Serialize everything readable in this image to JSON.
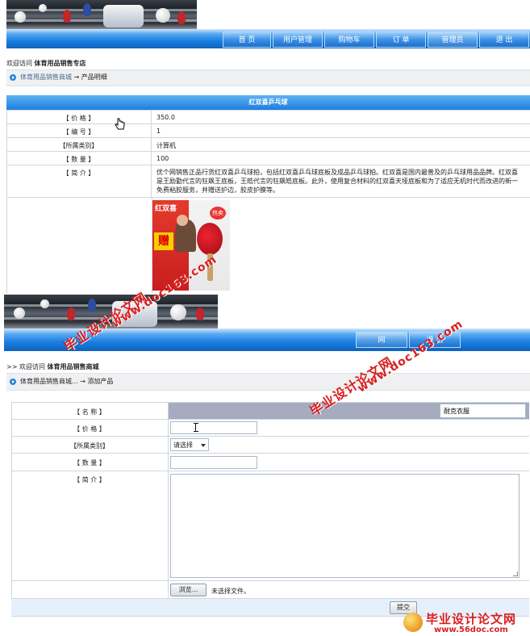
{
  "top": {
    "nav": [
      "首 页",
      "用户管理",
      "购物车",
      "订 单",
      "管理员",
      "退 出"
    ],
    "welcome_prefix": "欢迎访问",
    "welcome_site": "体育用品销售专店",
    "crumb_link": "体育用品销售商城",
    "crumb_arrow": "→",
    "crumb_page": "产品明细",
    "product_title": "红双喜乒乓球",
    "rows": [
      {
        "label": "【 价 格 】",
        "value": "350.0"
      },
      {
        "label": "【 编 号 】",
        "value": "1"
      },
      {
        "label": "【所属类别】",
        "value": "计算机"
      },
      {
        "label": "【 数 量 】",
        "value": "100"
      }
    ],
    "intro_label": "【 简 介 】",
    "intro_lines": [
      "优个网销售正品行货红双喜乒乓球拍，包括红双喜乒乓球底板及成品乒乓球拍。红双喜是国内最普及的乒乓球用品品牌。红双喜",
      "是王励勤代言的狂飙王底板，王皓代言的狂飙皓底板。此外，使用复合材料的红双喜天垭底板和为了适应无机时代而改进的新一",
      "免费粘胶服务，并赠送护边，胶皮护膜等。"
    ],
    "image_text": {
      "brand": "红双喜",
      "badge": "热卖",
      "gift": "赠"
    }
  },
  "bottom": {
    "nav": [
      "网",
      "退 出"
    ],
    "welcome_prefix": ">> 欢迎访问",
    "welcome_site": "体育用品销售商城",
    "crumb_link": "体育用品销售商城...",
    "crumb_arrow": "→",
    "crumb_page": "添加产品",
    "fields": {
      "name_label": "【 名 称 】",
      "name_value": "耐克衣服",
      "price_label": "【 价 格 】",
      "price_value": "",
      "category_label": "【所属类别】",
      "category_selected": "请选择",
      "quantity_label": "【 数 量 】",
      "quantity_value": "",
      "intro_label": "【 简 介 】",
      "intro_value": "",
      "browse_label": "浏览...",
      "file_status": "未选择文件。",
      "submit_label": "提交"
    }
  },
  "watermarks": {
    "cn": "毕业设计论文网",
    "url": "www.doc163.com",
    "corner_cn": "毕业设计论文网",
    "corner_url": "www.56doc.com"
  },
  "colors": {
    "nav_blue": "#1a7fe2",
    "header_blue": "#2d8ae4",
    "watermark_red": "#d92020"
  }
}
